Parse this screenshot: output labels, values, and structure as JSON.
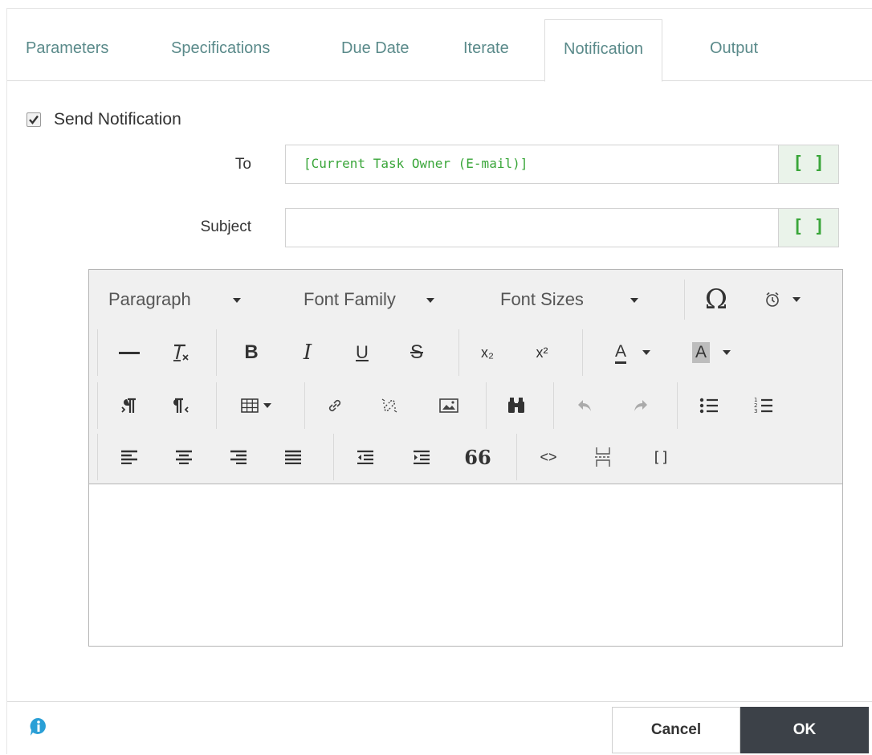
{
  "tabs": [
    {
      "label": "Parameters"
    },
    {
      "label": "Specifications"
    },
    {
      "label": "Due Date"
    },
    {
      "label": "Iterate"
    },
    {
      "label": "Notification",
      "active": true
    },
    {
      "label": "Output"
    }
  ],
  "send_notification": {
    "label": "Send Notification",
    "checked": true
  },
  "to": {
    "label": "To",
    "value": "[Current Task Owner (E-mail)]",
    "bracket": "[ ]"
  },
  "subject": {
    "label": "Subject",
    "value": "",
    "bracket": "[ ]"
  },
  "editor": {
    "paragraph": "Paragraph",
    "font_family": "Font Family",
    "font_sizes": "Font Sizes",
    "omega": "Ω",
    "bold": "B",
    "italic": "I",
    "underline": "U",
    "strike": "S",
    "sub": "x₂",
    "sup": "x²",
    "text_color": "A",
    "bg_color": "A",
    "quote": "66",
    "code": "<>",
    "bracket": "[]",
    "content": ""
  },
  "footer": {
    "cancel": "Cancel",
    "ok": "OK"
  },
  "colors": {
    "accent_tab": "#5a8a8a",
    "token_green": "#3aa63a",
    "ok_bg": "#3c4148",
    "info_blue": "#2a9fd6"
  }
}
